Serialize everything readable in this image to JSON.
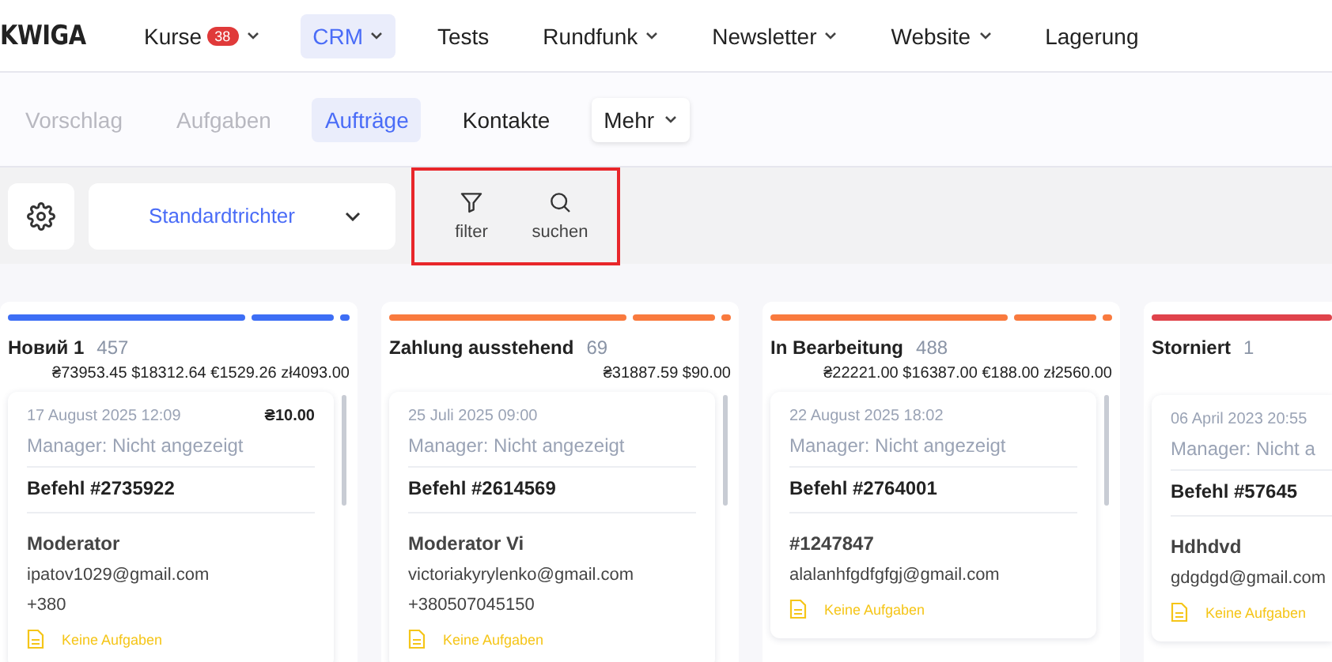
{
  "logo": "KWIGA",
  "nav": [
    {
      "label": "Kurse",
      "badge": "38",
      "dropdown": true,
      "selected": false
    },
    {
      "label": "CRM",
      "dropdown": true,
      "selected": true
    },
    {
      "label": "Tests",
      "dropdown": false,
      "selected": false
    },
    {
      "label": "Rundfunk",
      "dropdown": true,
      "selected": false
    },
    {
      "label": "Newsletter",
      "dropdown": true,
      "selected": false
    },
    {
      "label": "Website",
      "dropdown": true,
      "selected": false
    },
    {
      "label": "Lagerung",
      "dropdown": false,
      "selected": false
    }
  ],
  "subnav": [
    {
      "label": "Vorschlag",
      "selected": false,
      "disabled": true
    },
    {
      "label": "Aufgaben",
      "selected": false,
      "disabled": true
    },
    {
      "label": "Aufträge",
      "selected": true,
      "disabled": false
    },
    {
      "label": "Kontakte",
      "selected": false,
      "disabled": false
    }
  ],
  "more_menu": {
    "label": "Mehr"
  },
  "toolbar": {
    "funnel_select": "Standardtrichter",
    "actions": [
      {
        "kind": "filter",
        "label": "filter"
      },
      {
        "kind": "search",
        "label": "suchen"
      }
    ],
    "highlighted": true
  },
  "columns": [
    {
      "title": "Новий 1",
      "count": "457",
      "totals": "₴73953.45 $18312.64 €1529.26 zł4093.00",
      "color": "#3d6ef5",
      "cards": [
        {
          "date": "17 August 2025 12:09",
          "amount": "₴10.00",
          "manager": "Manager: Nicht angezeigt",
          "order": "Befehl #2735922",
          "name": "Moderator",
          "email": "ipatov1029@gmail.com",
          "phone": "+380",
          "tasks": "Keine Aufgaben"
        }
      ]
    },
    {
      "title": "Zahlung ausstehend",
      "count": "69",
      "totals": "₴31887.59 $90.00",
      "color": "#f97a3e",
      "cards": [
        {
          "date": "25 Juli 2025 09:00",
          "manager": "Manager: Nicht angezeigt",
          "order": "Befehl #2614569",
          "name": "Moderator Vi",
          "email": "victoriakyrylenko@gmail.com",
          "phone": "+380507045150",
          "tasks": "Keine Aufgaben"
        }
      ]
    },
    {
      "title": "In Bearbeitung",
      "count": "488",
      "totals": "₴22221.00 $16387.00 €188.00 zł2560.00",
      "color": "#f97a3e",
      "cards": [
        {
          "date": "22 August 2025 18:02",
          "manager": "Manager: Nicht angezeigt",
          "order": "Befehl #2764001",
          "name": "#1247847",
          "email": "alalanhfgdfgfgj@gmail.com",
          "tasks": "Keine Aufgaben"
        }
      ]
    },
    {
      "title": "Storniert",
      "count": "1",
      "color": "#e0434b",
      "cards": [
        {
          "date": "06 April 2023 20:55",
          "manager": "Manager: Nicht a",
          "order": "Befehl #57645",
          "name": "Hdhdvd",
          "email": "gdgdgd@gmail.com",
          "tasks": "Keine Aufgaben"
        }
      ]
    }
  ]
}
